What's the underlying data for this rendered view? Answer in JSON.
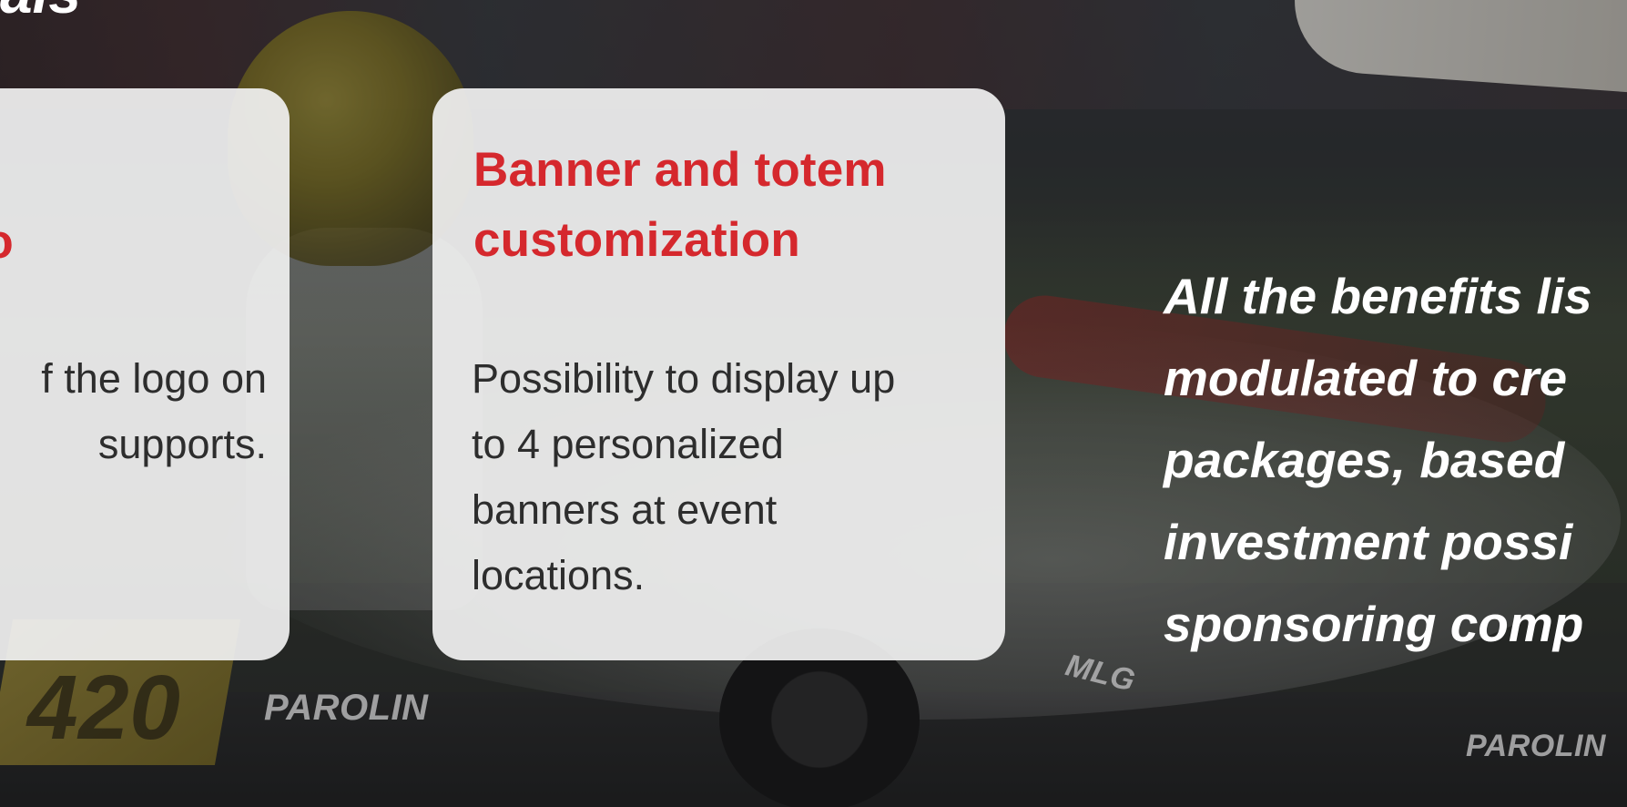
{
  "section": {
    "heading_fragment": "als"
  },
  "cards": [
    {
      "title_fragment": "o",
      "text_lines": [
        "f the logo on",
        "supports."
      ]
    },
    {
      "title_lines": [
        "Banner and totem",
        "customization"
      ],
      "text_lines": [
        "Possibility to display up",
        "to 4 personalized",
        "banners at event",
        "locations."
      ]
    }
  ],
  "benefits": {
    "lines": [
      "All the benefits lis",
      "modulated to cre",
      "packages, based",
      "investment possi",
      "sponsoring comp"
    ]
  },
  "background": {
    "kart_logos": [
      "PAROLIN",
      "PAROLIN",
      "MLG"
    ],
    "kart_number": "420"
  },
  "colors": {
    "accent_red": "#d5282d",
    "card_bg": "#f0f0f0",
    "body_text": "#2d2d2d"
  }
}
